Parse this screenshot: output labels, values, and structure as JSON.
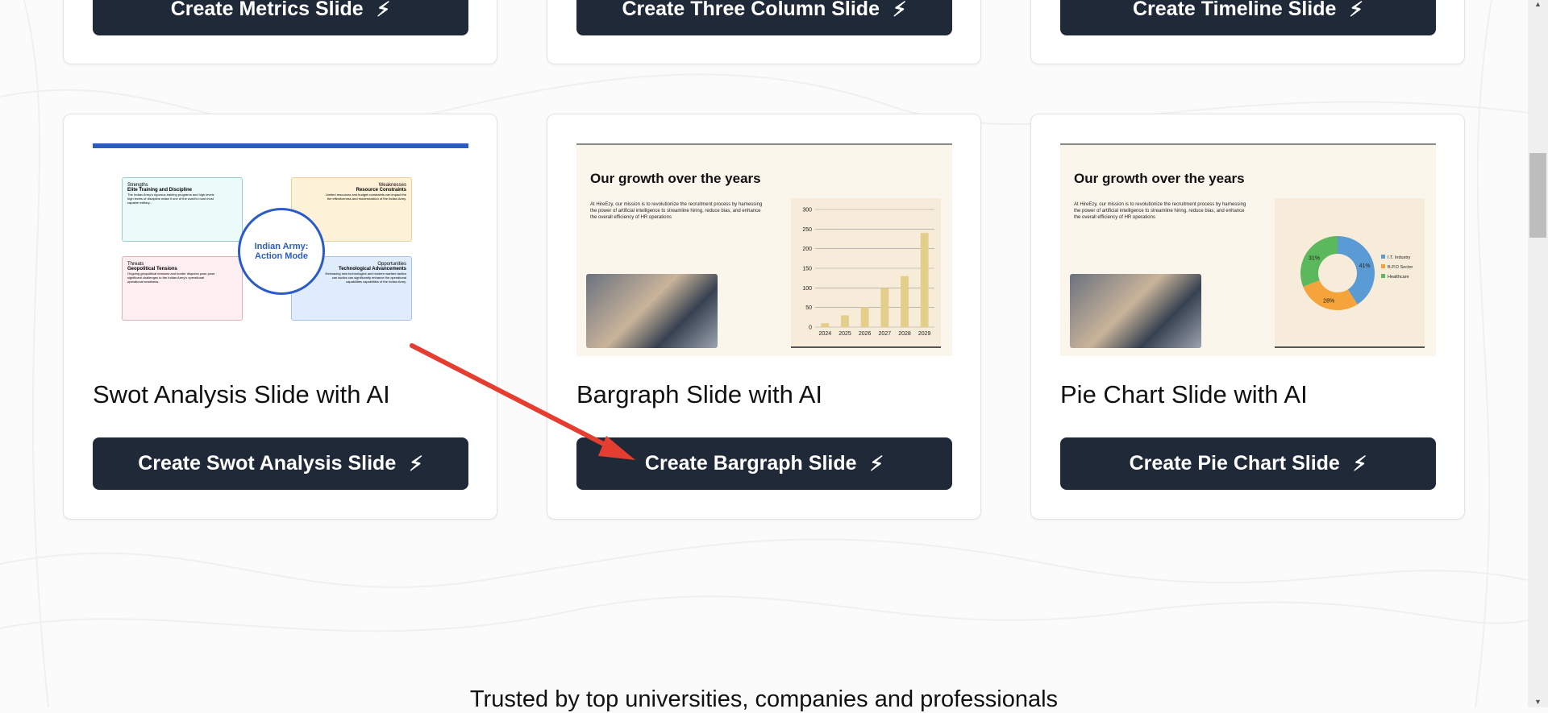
{
  "top_row": [
    {
      "button": "Create Metrics Slide"
    },
    {
      "button": "Create Three Column Slide"
    },
    {
      "button": "Create Timeline Slide"
    }
  ],
  "cards": [
    {
      "title": "Swot Analysis Slide with AI",
      "button": "Create Swot Analysis Slide",
      "preview": {
        "center": "Indian Army: Action Mode",
        "quadrants": [
          {
            "label": "Strengths",
            "heading": "Elite Training and Discipline",
            "text": "The Indian Army's rigorous training programs and high levels high levels of discipline make it one of the world's most most capable military..."
          },
          {
            "label": "Weaknesses",
            "heading": "Resource Constraints",
            "text": "Limited resources and budget constraints can impact the the effectiveness and modernization of the Indian Army."
          },
          {
            "label": "Threats",
            "heading": "Geopolitical Tensions",
            "text": "Ongoing geopolitical tensions and border disputes pose pose significant challenges to the Indian Army's operational operational readiness."
          },
          {
            "label": "Opportunities",
            "heading": "Technological Advancements",
            "text": "Embracing new technologies and modern warfare tactics can tactics can significantly enhance the operational capabilities capabilities of the Indian Army."
          }
        ]
      }
    },
    {
      "title": "Bargraph Slide with AI",
      "button": "Create Bargraph Slide",
      "preview": {
        "heading": "Our growth over the years",
        "text": "At HireEzy, our mission is to revolutionize the recruitment process by harnessing the power of artificial intelligence to streamline hiring, reduce bias, and enhance the overall efficiency of HR operations"
      }
    },
    {
      "title": "Pie Chart Slide with AI",
      "button": "Create Pie Chart Slide",
      "preview": {
        "heading": "Our growth over the years",
        "text": "At HireEzy, our mission is to revolutionize the recruitment process by harnessing the power of artificial intelligence to streamline hiring, reduce bias, and enhance the overall efficiency of HR operations"
      }
    }
  ],
  "chart_data": [
    {
      "type": "bar",
      "categories": [
        "2024",
        "2025",
        "2026",
        "2027",
        "2028",
        "2029"
      ],
      "values": [
        10,
        30,
        50,
        100,
        130,
        240
      ],
      "ylim": [
        0,
        300
      ],
      "yticks": [
        "0",
        "50",
        "100",
        "150",
        "200",
        "250",
        "300"
      ],
      "color": "#e3cf8a"
    },
    {
      "type": "pie",
      "labels": [
        "I.T. Industry",
        "B.P.O Sector",
        "Healthcare"
      ],
      "values": [
        41,
        28,
        31
      ],
      "value_labels": [
        "41%",
        "28%",
        "31%"
      ],
      "colors": [
        "#5b9bd5",
        "#f4a43a",
        "#5cb85c"
      ]
    }
  ],
  "footer": {
    "trusted": "Trusted by top universities, companies and professionals"
  },
  "colors": {
    "button": "#1f2937",
    "arrow": "#e53e30",
    "accent": "#2a5bc7"
  }
}
